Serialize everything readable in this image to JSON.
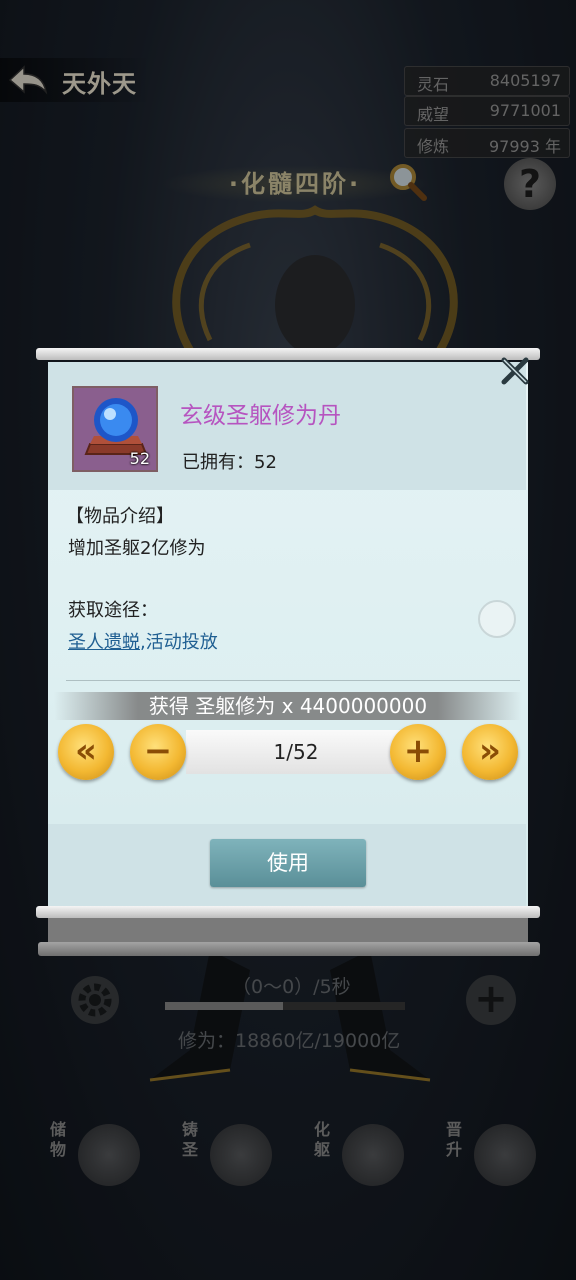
{
  "header": {
    "back_title": "天外天",
    "stats": [
      {
        "label": "灵石",
        "value": "8405197"
      },
      {
        "label": "威望",
        "value": "9771001"
      },
      {
        "label": "修炼",
        "value": "97993 年"
      }
    ],
    "realm_title": "·化髓四阶·",
    "help_label": "?"
  },
  "background": {
    "timer_text": "（0～0）/5秒",
    "cultivation_text": "修为：18860亿/19000亿",
    "cultivation_progress": 0.49,
    "nav": [
      {
        "label": "储物",
        "icon": "bag-icon"
      },
      {
        "label": "铸圣",
        "icon": "forge-icon"
      },
      {
        "label": "化躯",
        "icon": "transform-icon"
      },
      {
        "label": "晋升",
        "icon": "ascend-icon"
      }
    ]
  },
  "modal": {
    "item": {
      "name": "玄级圣躯修为丹",
      "count_badge": "52",
      "owned_label": "已拥有：52",
      "icon": "orb-icon"
    },
    "intro_title": "【物品介绍】",
    "intro_text": "增加圣躯2亿修为",
    "source_title": "获取途径：",
    "source_link": "圣人遗蜕",
    "source_rest": ",活动投放",
    "gain_text": "获得 圣躯修为 x 4400000000",
    "quantity": "1/52",
    "first_label": "«",
    "last_label": "»",
    "minus_label": "−",
    "plus_label": "+",
    "use_label": "使用"
  },
  "colors": {
    "item_name": "#b654c0",
    "link": "#1f5f92",
    "gold": "#f3b832",
    "use_button": "#6ea3ab"
  }
}
